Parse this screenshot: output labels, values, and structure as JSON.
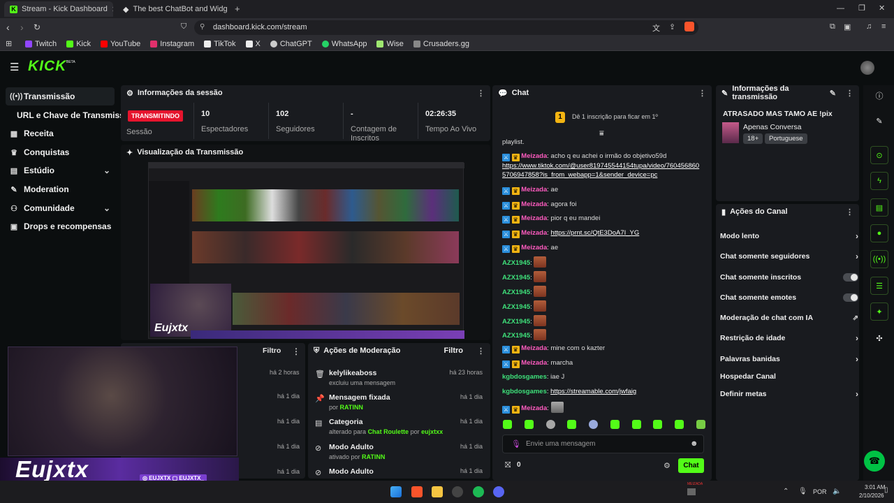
{
  "browser": {
    "tabs": [
      {
        "label": "Stream - Kick Dashboard"
      },
      {
        "label": "The best ChatBot and Widgets for Ki"
      }
    ],
    "url": "dashboard.kick.com/stream",
    "bookmarks": [
      {
        "label": "Twitch",
        "color": "#9146ff"
      },
      {
        "label": "Kick",
        "color": "#53fc18"
      },
      {
        "label": "YouTube",
        "color": "#ff0000"
      },
      {
        "label": "Instagram",
        "color": "#e1306c"
      },
      {
        "label": "TikTok",
        "color": "#ffffff"
      },
      {
        "label": "X",
        "color": "#ffffff"
      },
      {
        "label": "ChatGPT",
        "color": "#cccccc"
      },
      {
        "label": "WhatsApp",
        "color": "#25d366"
      },
      {
        "label": "Wise",
        "color": "#9fe870"
      },
      {
        "label": "Crusaders.gg",
        "color": "#888888"
      }
    ]
  },
  "header": {
    "logo": "KICK",
    "beta": "BETA"
  },
  "sidebar": {
    "items": [
      {
        "label": "Transmissão",
        "icon": "broadcast-icon"
      },
      {
        "label": "URL e Chave de Transmissão",
        "icon": ""
      },
      {
        "label": "Receita",
        "icon": "revenue-icon"
      },
      {
        "label": "Conquistas",
        "icon": "trophy-icon"
      },
      {
        "label": "Estúdio",
        "icon": "studio-icon"
      },
      {
        "label": "Moderation",
        "icon": "wrench-icon"
      },
      {
        "label": "Comunidade",
        "icon": "community-icon"
      },
      {
        "label": "Drops e recompensas",
        "icon": "drops-icon"
      }
    ]
  },
  "session": {
    "title": "Informações da sessão",
    "status": "TRANSMITINDO",
    "status_label": "Sessão",
    "stats": [
      {
        "value": "10",
        "label": "Espectadores"
      },
      {
        "value": "102",
        "label": "Seguidores"
      },
      {
        "value": "-",
        "label": "Contagem de Inscritos"
      },
      {
        "value": "02:26:35",
        "label": "Tempo Ao Vivo"
      }
    ]
  },
  "preview": {
    "title": "Visualização da Transmissão",
    "overlay_name": "Eujxtx"
  },
  "activity": {
    "filter": "Filtro",
    "times": [
      "há 2 horas",
      "há 1 dia",
      "há 1 dia",
      "há 1 dia",
      "há 1 dia"
    ]
  },
  "moderation": {
    "title": "Ações de Moderação",
    "filter": "Filtro",
    "rows": [
      {
        "title": "kelylikeaboss",
        "sub": "excluiu uma mensagem",
        "hl": "",
        "time": "há 23 horas",
        "icon": "trash-icon"
      },
      {
        "title": "Mensagem fixada",
        "sub": "por",
        "hl": "RATINN",
        "time": "há 1 dia",
        "icon": "pin-icon"
      },
      {
        "title": "Categoria",
        "sub": "alterado para",
        "hl": "Chat Roulette",
        "sub2": "por",
        "hl2": "eujxtxx",
        "time": "há 1 dia",
        "icon": "category-icon"
      },
      {
        "title": "Modo Adulto",
        "sub": "ativado por",
        "hl": "RATINN",
        "time": "há 1 dia",
        "icon": "adult-icon"
      },
      {
        "title": "Modo Adulto",
        "sub": "",
        "hl": "",
        "time": "há 1 dia",
        "icon": "adult-icon"
      }
    ]
  },
  "chat": {
    "title": "Chat",
    "banner": "Dê 1 inscrição para ficar em 1º",
    "banner_rank": "1",
    "messages": [
      {
        "text": "playlist."
      },
      {
        "user": "Meizada",
        "text": "acho q eu achei o irmão do objetivo59d"
      },
      {
        "link": "https://www.tiktok.com/@user819745544154tupa/video/760456860"
      },
      {
        "link": "5706947858?is_from_webapp=1&sender_device=pc"
      },
      {
        "user": "Meizada",
        "text": "ae"
      },
      {
        "user": "Meizada",
        "text": "agora foi"
      },
      {
        "user": "Meizada",
        "text": "pior q eu mandei"
      },
      {
        "user": "Meizada",
        "link": "https://prnt.sc/QtE3DoA7I_YG"
      },
      {
        "user": "Meizada",
        "text": "ae"
      },
      {
        "user": "AZX1945",
        "emote": true
      },
      {
        "user": "AZX1945",
        "emote": true
      },
      {
        "user": "AZX1945",
        "emote": true
      },
      {
        "user": "AZX1945",
        "emote": true
      },
      {
        "user": "AZX1945",
        "emote": true
      },
      {
        "user": "AZX1945",
        "emote": true
      },
      {
        "user": "Meizada",
        "text": "mine com o kazter"
      },
      {
        "user": "Meizada",
        "text": "marcha"
      },
      {
        "user": "kgbdosgames",
        "text": "iae J"
      },
      {
        "user": "kgbdosgames",
        "link": "https://streamable.com/jwfaig"
      },
      {
        "user": "Meizada",
        "emote": true
      }
    ],
    "input_placeholder": "Envie uma mensagem",
    "points": "0",
    "send": "Chat"
  },
  "transmission_info": {
    "title": "Informações da transmissão",
    "stream_title": "ATRASADO MAS TAMO AE !pix",
    "category": "Apenas Conversa",
    "tags": [
      "18+",
      "Portuguese"
    ]
  },
  "channel_actions": {
    "title": "Ações do Canal",
    "items": [
      {
        "label": "Modo lento",
        "ctrl": "chevron"
      },
      {
        "label": "Chat somente seguidores",
        "ctrl": "chevron"
      },
      {
        "label": "Chat somente inscritos",
        "ctrl": "toggle"
      },
      {
        "label": "Chat somente emotes",
        "ctrl": "toggle"
      },
      {
        "label": "Moderação de chat com IA",
        "ctrl": "external"
      },
      {
        "label": "Restrição de idade",
        "ctrl": "chevron"
      },
      {
        "label": "Palavras banidas",
        "ctrl": "chevron"
      },
      {
        "label": "Hospedar Canal",
        "ctrl": ""
      },
      {
        "label": "Definir metas",
        "ctrl": "chevron"
      }
    ]
  },
  "webcam": {
    "name": "Eujxtx",
    "handle1": "EUJXTX",
    "handle2": "EUJXTX_"
  },
  "taskbar": {
    "lang": "POR",
    "time": "3:01 AM",
    "date": "2/10/2026",
    "tray_label": "MEIZADA"
  }
}
